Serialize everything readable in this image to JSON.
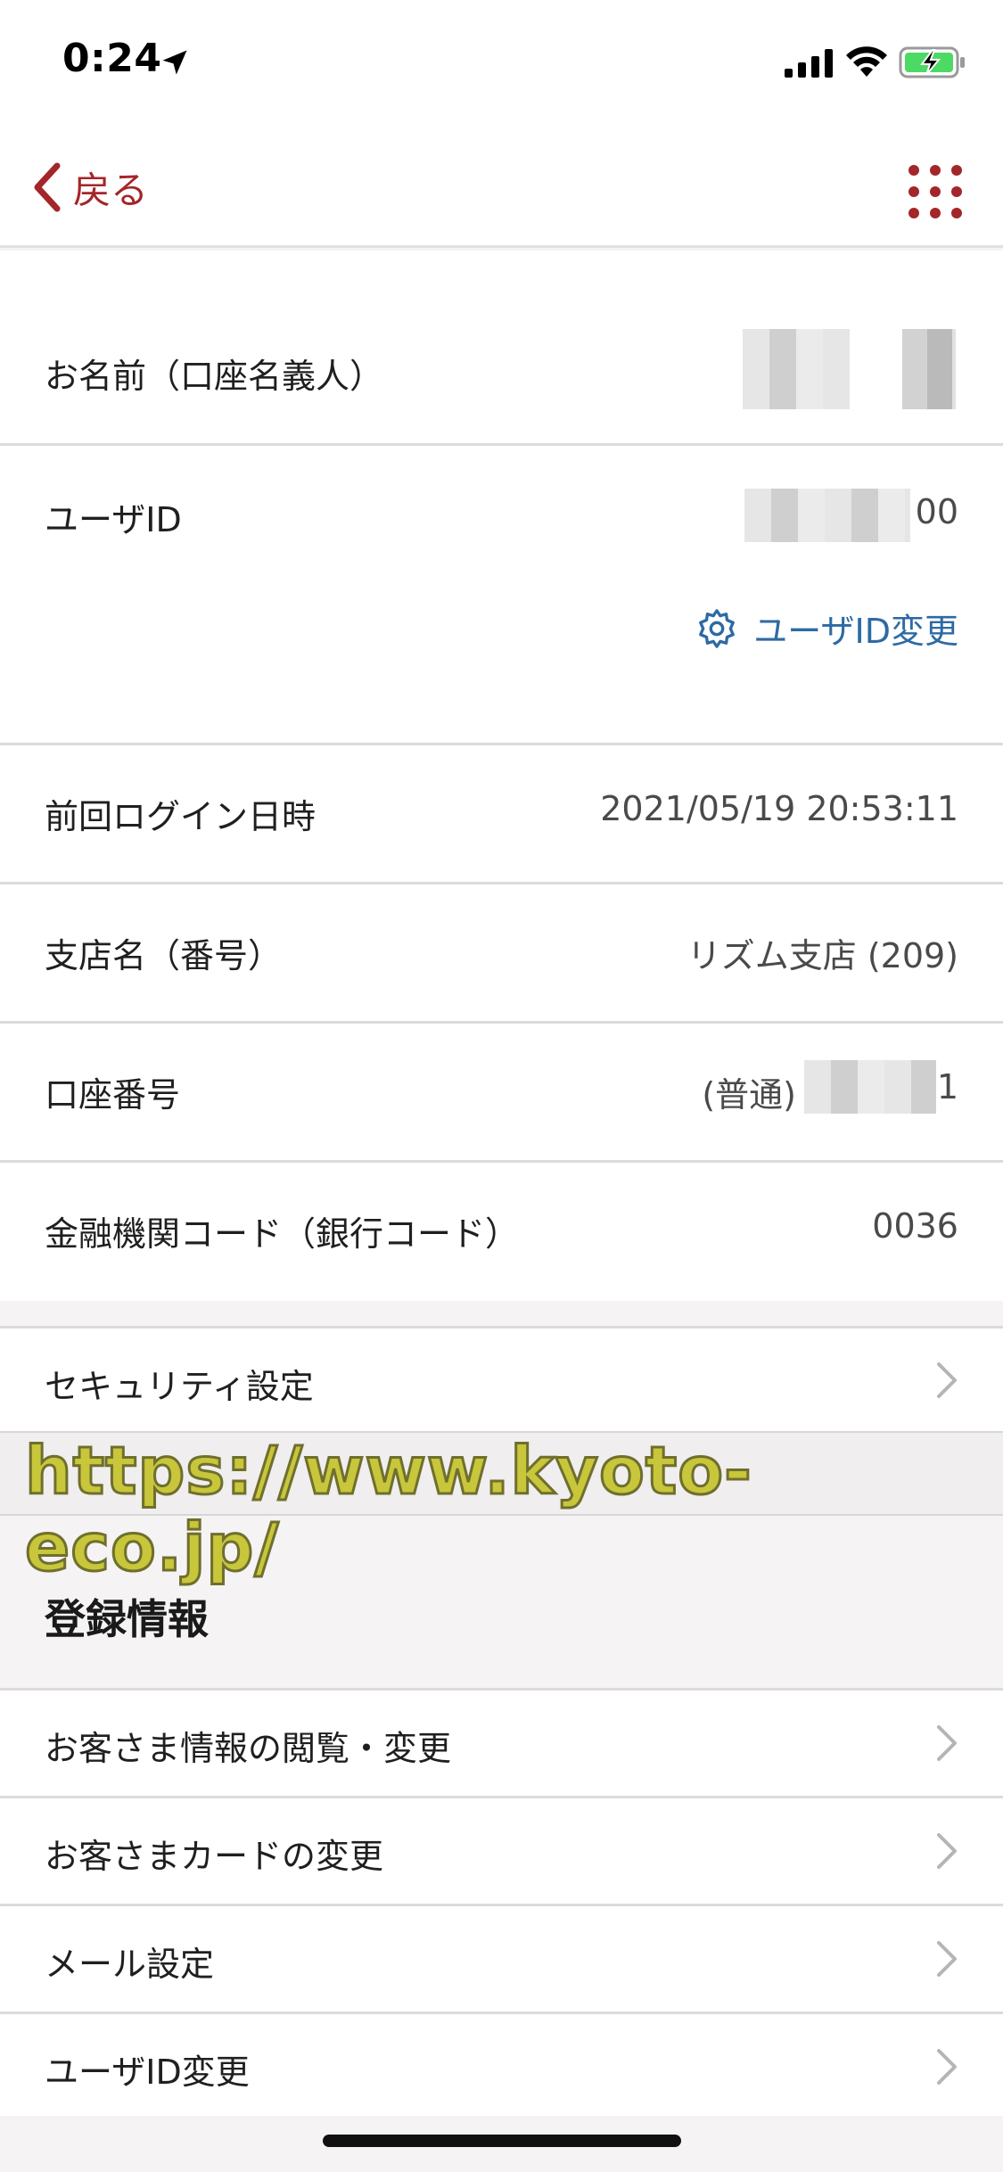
{
  "status_bar": {
    "time": "0:24"
  },
  "nav": {
    "back_label": "戻る"
  },
  "account": {
    "name_label": "お名前（口座名義人）",
    "user_id_label": "ユーザID",
    "user_id_suffix": "00",
    "user_id_change_link": "ユーザID変更",
    "last_login_label": "前回ログイン日時",
    "last_login_value": "2021/05/19 20:53:11",
    "branch_label": "支店名（番号）",
    "branch_value": "リズム支店 (209)",
    "account_number_label": "口座番号",
    "account_type": "(普通)",
    "account_number_suffix": "1",
    "bank_code_label": "金融機関コード（銀行コード）",
    "bank_code_value": "0036"
  },
  "security": {
    "label": "セキュリティ設定"
  },
  "watermark": {
    "text": "https://www.kyoto-eco.jp/"
  },
  "registration": {
    "title": "登録情報",
    "items": [
      {
        "label": "お客さま情報の閲覧・変更"
      },
      {
        "label": "お客さまカードの変更"
      },
      {
        "label": "メール設定"
      },
      {
        "label": "ユーザID変更"
      }
    ]
  },
  "colors": {
    "accent_red": "#a3262a",
    "link_blue": "#2d6aa3",
    "background": "#f5f3f3"
  },
  "icons": {
    "back": "chevron-left-icon",
    "menu": "grid-menu-icon",
    "settings": "gear-icon",
    "row_disclosure": "chevron-right-icon"
  }
}
